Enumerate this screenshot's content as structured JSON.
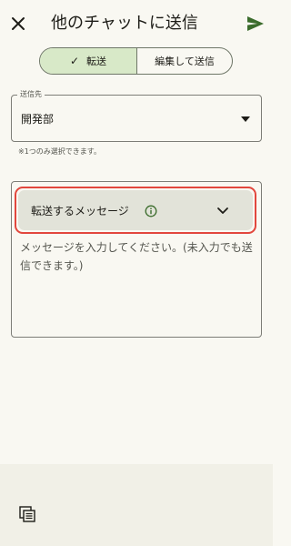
{
  "header": {
    "title": "他のチャットに送信",
    "close_icon": "close-icon",
    "send_icon": "send-icon"
  },
  "mode_toggle": {
    "forward_label": "転送",
    "edit_label": "編集して送信",
    "selected": "forward",
    "check_glyph": "✓"
  },
  "destination": {
    "label": "送信先",
    "value": "開発部",
    "helper": "※1つのみ選択できます。"
  },
  "message": {
    "forward_chip_label": "転送するメッセージ",
    "placeholder": "メッセージを入力してください。(未入力でも送信できます。)",
    "highlight_color": "#e2473d"
  },
  "colors": {
    "background": "#f9f8f2",
    "accent_green": "#3b6c2c",
    "selected_segment": "#d8e9c8",
    "chip_background": "#e2e3d9",
    "bottom_bar": "#f1f0e7"
  },
  "bottom_bar": {
    "icon": "copy-stack-icon"
  }
}
